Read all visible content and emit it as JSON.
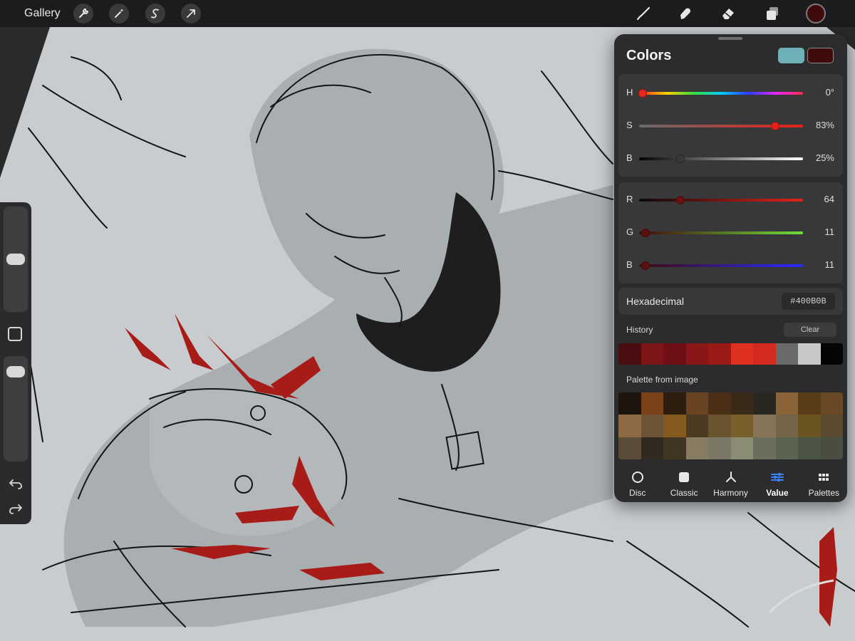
{
  "toolbar": {
    "gallery_label": "Gallery",
    "left_tools": [
      "wrench-icon",
      "magic-wand-icon",
      "selection-icon",
      "transform-arrow-icon"
    ],
    "right_tools": [
      "brush-icon",
      "smudge-icon",
      "eraser-icon",
      "layers-icon"
    ],
    "current_color": "#400b0b"
  },
  "sidebar": {
    "brush_size_level": 0.5,
    "opacity_level": 0.93
  },
  "colors_panel": {
    "title": "Colors",
    "secondary_color": "#6fb0b8",
    "primary_color": "#400b0b",
    "hsb": [
      {
        "label": "H",
        "value": "0°",
        "level": 0.02
      },
      {
        "label": "S",
        "value": "83%",
        "level": 0.83
      },
      {
        "label": "B",
        "value": "25%",
        "level": 0.25
      }
    ],
    "rgb": [
      {
        "label": "R",
        "value": "64",
        "level": 0.25
      },
      {
        "label": "G",
        "value": "11",
        "level": 0.04
      },
      {
        "label": "B",
        "value": "11",
        "level": 0.04
      }
    ],
    "hex_label": "Hexadecimal",
    "hex_value": "#400B0B",
    "history_label": "History",
    "clear_label": "Clear",
    "history": [
      "#4a0d10",
      "#7c1418",
      "#6e1016",
      "#8a1618",
      "#9a1a16",
      "#e03020",
      "#d42a22",
      "#6a6a6a",
      "#c8c8c8",
      "#050505"
    ],
    "palette_label": "Palette from image",
    "palette": [
      "#1e140e",
      "#7a4218",
      "#2e1e10",
      "#6a4422",
      "#4a2e16",
      "#3a2a1a",
      "#2a2620",
      "#8a6438",
      "#5a3c18",
      "#6a4a24",
      "#8e6a44",
      "#6e5436",
      "#845a1e",
      "#4a3a22",
      "#6a5430",
      "#7a5e2c",
      "#867458",
      "#746448",
      "#6a5420",
      "#5a4a30",
      "#5a4c38",
      "#322a20",
      "#403624",
      "#887c62",
      "#7c7868",
      "#8a8c74",
      "#6c6e5c",
      "#5c6250",
      "#4c5444",
      "#4a4e40"
    ],
    "tabs": [
      {
        "label": "Disc",
        "icon": "disc-icon"
      },
      {
        "label": "Classic",
        "icon": "classic-square-icon"
      },
      {
        "label": "Harmony",
        "icon": "harmony-icon"
      },
      {
        "label": "Value",
        "icon": "value-sliders-icon"
      },
      {
        "label": "Palettes",
        "icon": "palettes-grid-icon"
      }
    ]
  }
}
